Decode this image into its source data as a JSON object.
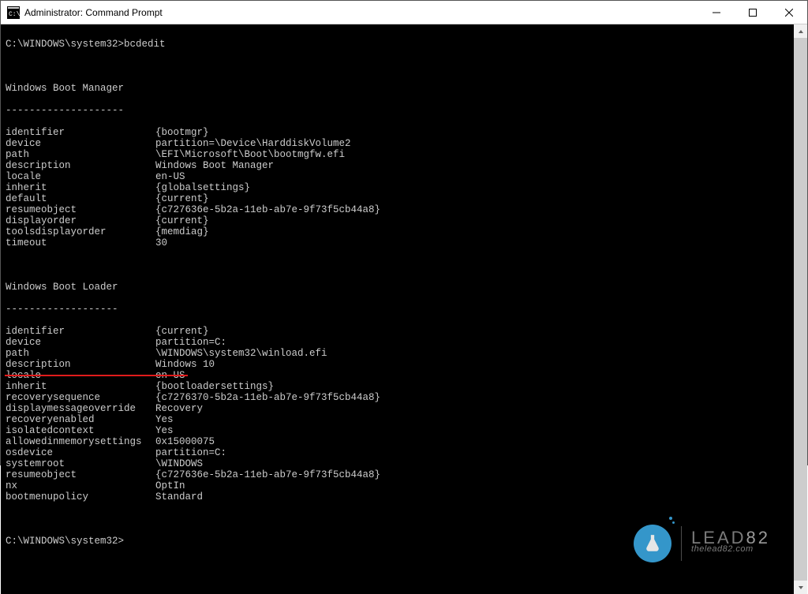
{
  "window": {
    "title": "Administrator: Command Prompt"
  },
  "prompt1": "C:\\WINDOWS\\system32>bcdedit",
  "prompt2": "C:\\WINDOWS\\system32>",
  "section1": {
    "title": "Windows Boot Manager",
    "dashes": "--------------------",
    "rows": [
      {
        "k": "identifier",
        "v": "{bootmgr}"
      },
      {
        "k": "device",
        "v": "partition=\\Device\\HarddiskVolume2"
      },
      {
        "k": "path",
        "v": "\\EFI\\Microsoft\\Boot\\bootmgfw.efi"
      },
      {
        "k": "description",
        "v": "Windows Boot Manager"
      },
      {
        "k": "locale",
        "v": "en-US"
      },
      {
        "k": "inherit",
        "v": "{globalsettings}"
      },
      {
        "k": "default",
        "v": "{current}"
      },
      {
        "k": "resumeobject",
        "v": "{c727636e-5b2a-11eb-ab7e-9f73f5cb44a8}"
      },
      {
        "k": "displayorder",
        "v": "{current}"
      },
      {
        "k": "toolsdisplayorder",
        "v": "{memdiag}"
      },
      {
        "k": "timeout",
        "v": "30"
      }
    ]
  },
  "section2": {
    "title": "Windows Boot Loader",
    "dashes": "-------------------",
    "rows": [
      {
        "k": "identifier",
        "v": "{current}"
      },
      {
        "k": "device",
        "v": "partition=C:"
      },
      {
        "k": "path",
        "v": "\\WINDOWS\\system32\\winload.efi"
      },
      {
        "k": "description",
        "v": "Windows 10"
      },
      {
        "k": "locale",
        "v": "en-US"
      },
      {
        "k": "inherit",
        "v": "{bootloadersettings}"
      },
      {
        "k": "recoverysequence",
        "v": "{c7276370-5b2a-11eb-ab7e-9f73f5cb44a8}"
      },
      {
        "k": "displaymessageoverride",
        "v": "Recovery"
      },
      {
        "k": "recoveryenabled",
        "v": "Yes"
      },
      {
        "k": "isolatedcontext",
        "v": "Yes"
      },
      {
        "k": "allowedinmemorysettings",
        "v": "0x15000075"
      },
      {
        "k": "osdevice",
        "v": "partition=C:"
      },
      {
        "k": "systemroot",
        "v": "\\WINDOWS"
      },
      {
        "k": "resumeobject",
        "v": "{c727636e-5b2a-11eb-ab7e-9f73f5cb44a8}"
      },
      {
        "k": "nx",
        "v": "OptIn"
      },
      {
        "k": "bootmenupolicy",
        "v": "Standard"
      }
    ]
  },
  "watermark": {
    "brand_prefix": "LEAD",
    "brand_suffix": "82",
    "url": "thelead82.com"
  }
}
